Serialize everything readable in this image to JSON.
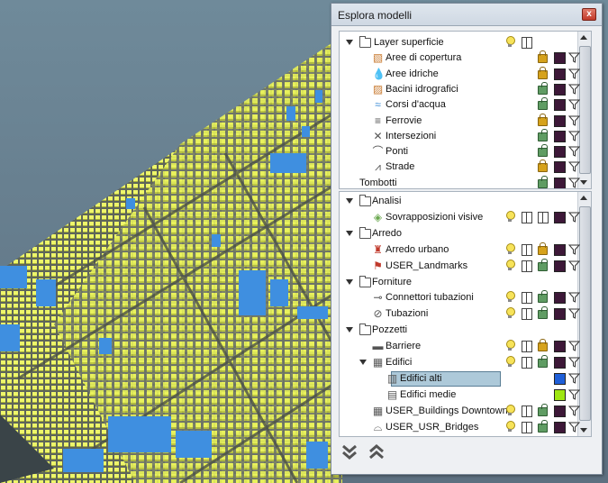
{
  "panel": {
    "title": "Esplora modelli",
    "close_label": "x"
  },
  "top_list": {
    "rows": [
      {
        "label": "Layer superficie",
        "type": "group",
        "bulb": true,
        "book": true
      },
      {
        "label": "Aree di copertura",
        "icon": "area-icon",
        "lock": "gold",
        "swatch": "#3d1838"
      },
      {
        "label": "Aree idriche",
        "icon": "water-drop-icon",
        "lock": "gold",
        "swatch": "#3d1838"
      },
      {
        "label": "Bacini idrografici",
        "icon": "basin-icon",
        "lock": "green",
        "swatch": "#3d1838"
      },
      {
        "label": "Corsi d'acqua",
        "icon": "watercourse-icon",
        "lock": "green",
        "swatch": "#3d1838"
      },
      {
        "label": "Ferrovie",
        "icon": "railway-icon",
        "lock": "gold",
        "swatch": "#3d1838"
      },
      {
        "label": "Intersezioni",
        "icon": "intersection-icon",
        "lock": "green",
        "swatch": "#3d1838"
      },
      {
        "label": "Ponti",
        "icon": "bridge-icon",
        "lock": "green",
        "swatch": "#3d1838"
      },
      {
        "label": "Strade",
        "icon": "road-icon",
        "lock": "gold",
        "swatch": "#3d1838"
      },
      {
        "label": "Tombotti",
        "icon": "",
        "lock": "green",
        "swatch": "#3d1838"
      }
    ]
  },
  "bottom_list": {
    "rows": [
      {
        "label": "Analisi",
        "type": "group"
      },
      {
        "label": "Sovrapposizioni visive",
        "icon": "overlay-icon",
        "bulb": true,
        "book": true,
        "book2": true,
        "swatch": "#3d1838"
      },
      {
        "label": "Arredo",
        "type": "group"
      },
      {
        "label": "Arredo urbano",
        "icon": "hydrant-icon",
        "bulb": true,
        "book": true,
        "lock": "gold",
        "swatch": "#3d1838"
      },
      {
        "label": "USER_Landmarks",
        "icon": "landmark-icon",
        "bulb": true,
        "book": true,
        "lock": "green",
        "swatch": "#3d1838"
      },
      {
        "label": "Forniture",
        "type": "group"
      },
      {
        "label": "Connettori tubazioni",
        "icon": "connector-icon",
        "bulb": true,
        "book": true,
        "lock": "green",
        "swatch": "#3d1838"
      },
      {
        "label": "Tubazioni",
        "icon": "pipe-icon",
        "bulb": true,
        "book": true,
        "lock": "green",
        "swatch": "#3d1838"
      },
      {
        "label": "Pozzetti",
        "type": "group"
      },
      {
        "label": "Barriere",
        "icon": "barrier-icon",
        "bulb": true,
        "book": true,
        "lock": "gold",
        "swatch": "#3d1838"
      },
      {
        "label": "Edifici",
        "icon": "building-icon",
        "type": "subgroup",
        "bulb": true,
        "book": true,
        "lock": "green",
        "swatch": "#3d1838"
      },
      {
        "label": "Edifici alti",
        "icon": "building-tall-icon",
        "selected": true,
        "swatch": "#1f5fd8"
      },
      {
        "label": "Edifici medie",
        "icon": "building-mid-icon",
        "swatch": "#9ee612"
      },
      {
        "label": "USER_Buildings Downtown",
        "icon": "building-icon",
        "bulb": true,
        "book": true,
        "lock": "green",
        "swatch": "#3d1838"
      },
      {
        "label": "USER_USR_Bridges",
        "icon": "bridge-user-icon",
        "bulb": true,
        "book": true,
        "lock": "green",
        "swatch": "#3d1838"
      }
    ]
  },
  "footer": {
    "collapse_all_icon": "double-chevron-down-icon",
    "expand_all_icon": "double-chevron-up-icon"
  }
}
